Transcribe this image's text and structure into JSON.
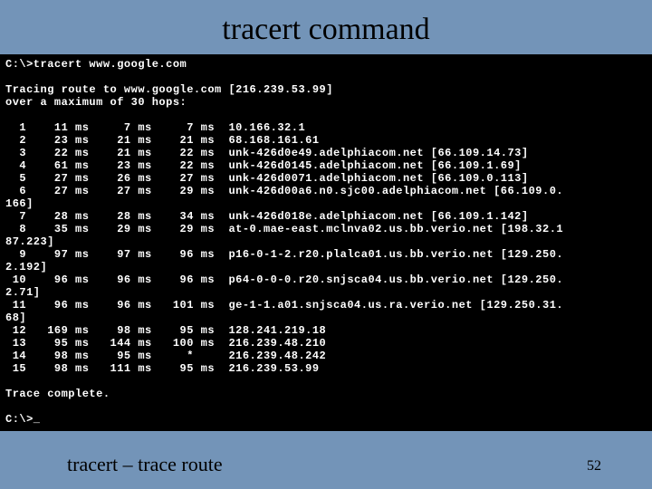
{
  "title": "tracert command",
  "terminal": {
    "prompt1": "C:\\>tracert www.google.com",
    "blank1": "",
    "tracing": "Tracing route to www.google.com [216.239.53.99]",
    "over": "over a maximum of 30 hops:",
    "blank2": "",
    "hops": [
      "  1    11 ms     7 ms     7 ms  10.166.32.1",
      "  2    23 ms    21 ms    21 ms  68.168.161.61",
      "  3    22 ms    21 ms    22 ms  unk-426d0e49.adelphiacom.net [66.109.14.73]",
      "  4    61 ms    23 ms    22 ms  unk-426d0145.adelphiacom.net [66.109.1.69]",
      "  5    27 ms    26 ms    27 ms  unk-426d0071.adelphiacom.net [66.109.0.113]",
      "  6    27 ms    27 ms    29 ms  unk-426d00a6.n0.sjc00.adelphiacom.net [66.109.0.",
      "166]",
      "  7    28 ms    28 ms    34 ms  unk-426d018e.adelphiacom.net [66.109.1.142]",
      "  8    35 ms    29 ms    29 ms  at-0.mae-east.mclnva02.us.bb.verio.net [198.32.1",
      "87.223]",
      "  9    97 ms    97 ms    96 ms  p16-0-1-2.r20.plalca01.us.bb.verio.net [129.250.",
      "2.192]",
      " 10    96 ms    96 ms    96 ms  p64-0-0-0.r20.snjsca04.us.bb.verio.net [129.250.",
      "2.71]",
      " 11    96 ms    96 ms   101 ms  ge-1-1.a01.snjsca04.us.ra.verio.net [129.250.31.",
      "68]",
      " 12   169 ms    98 ms    95 ms  128.241.219.18",
      " 13    95 ms   144 ms   100 ms  216.239.48.210",
      " 14    98 ms    95 ms     *     216.239.48.242",
      " 15    98 ms   111 ms    95 ms  216.239.53.99"
    ],
    "blank3": "",
    "complete": "Trace complete.",
    "blank4": "",
    "prompt2": "C:\\>_"
  },
  "footer": "tracert – trace route",
  "pagenum": "52"
}
